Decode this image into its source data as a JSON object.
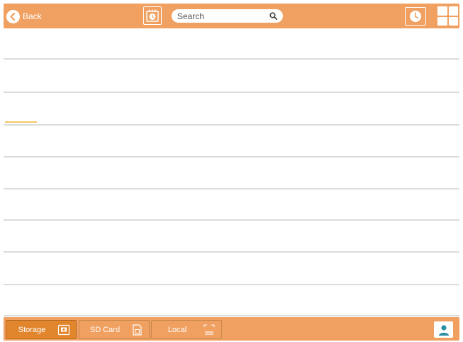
{
  "topbar": {
    "back_label": "Back",
    "search": {
      "placeholder": "Search",
      "value": ""
    },
    "icons": [
      "back-arrow-icon",
      "calendar-clock-icon",
      "search-icon",
      "clock-icon",
      "grid-view-icon"
    ]
  },
  "list": {
    "rows": [
      {
        "index": 1,
        "progress": 0
      },
      {
        "index": 2,
        "progress": 0
      },
      {
        "index": 3,
        "progress": 0.07
      },
      {
        "index": 4,
        "progress": 0
      },
      {
        "index": 5,
        "progress": 0
      },
      {
        "index": 6,
        "progress": 0
      },
      {
        "index": 7,
        "progress": 0
      },
      {
        "index": 8,
        "progress": 0
      },
      {
        "index": 9,
        "progress": 0
      }
    ]
  },
  "bottombar": {
    "tabs": [
      {
        "label": "Storage",
        "icon": "storage-icon",
        "active": true
      },
      {
        "label": "SD Card",
        "icon": "sd-card-icon",
        "active": false
      },
      {
        "label": "Local",
        "icon": "local-device-icon",
        "active": false
      }
    ],
    "account_icon": "user-account-icon"
  },
  "colors": {
    "bar": "#f0a060",
    "active_tab": "#e2862e",
    "divider": "#dcdcdc",
    "progress": "#f5c66a"
  }
}
